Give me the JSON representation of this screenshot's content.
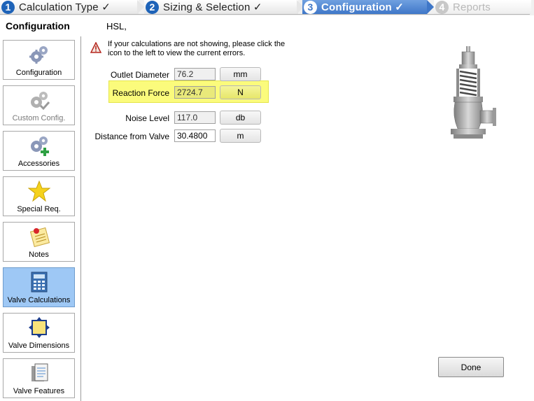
{
  "steps": [
    {
      "number": "1",
      "label": "Calculation Type ✓"
    },
    {
      "number": "2",
      "label": "Sizing & Selection ✓"
    },
    {
      "number": "3",
      "label": "Configuration ✓"
    },
    {
      "number": "4",
      "label": "Reports"
    }
  ],
  "sidebar": {
    "title": "Configuration",
    "items": [
      {
        "label": "Configuration",
        "icon": "gears-icon"
      },
      {
        "label": "Custom Config.",
        "icon": "gears-check-icon"
      },
      {
        "label": "Accessories",
        "icon": "gears-plus-icon"
      },
      {
        "label": "Special Req.",
        "icon": "star-icon"
      },
      {
        "label": "Notes",
        "icon": "notes-icon"
      },
      {
        "label": "Valve Calculations",
        "icon": "calculator-icon"
      },
      {
        "label": "Valve Dimensions",
        "icon": "dimensions-icon"
      },
      {
        "label": "Valve Features",
        "icon": "document-icon"
      }
    ]
  },
  "main": {
    "header": "HSL,",
    "warning": "If your calculations are not showing, please click the icon to the left to view the current errors.",
    "rows": [
      {
        "label": "Outlet Diameter",
        "value": "76.2",
        "unit": "mm"
      },
      {
        "label": "Reaction Force",
        "value": "2724.7",
        "unit": "N"
      },
      {
        "label": "Noise Level",
        "value": "117.0",
        "unit": "db"
      },
      {
        "label": "Distance from Valve",
        "value": "30.4800",
        "unit": "m"
      }
    ],
    "done_label": "Done"
  },
  "colors": {
    "active_step": "#3f77c8",
    "step_number": "#1e63b8",
    "active_nav": "#9ec8f5",
    "highlight": "#fbfb7c"
  }
}
